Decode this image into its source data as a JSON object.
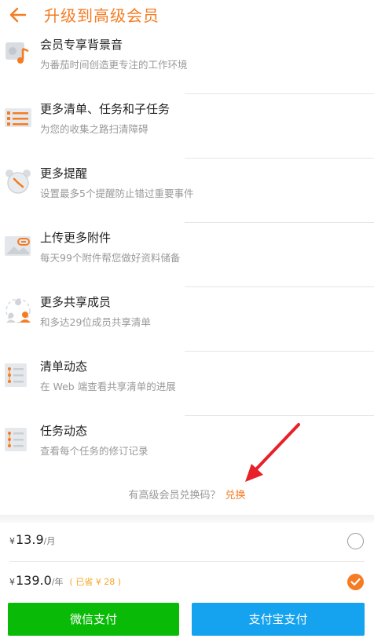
{
  "header": {
    "title": "升级到高级会员"
  },
  "features": [
    {
      "title": "会员专享背景音",
      "desc": "为番茄时间创造更专注的工作环境",
      "icon": "music-note-icon"
    },
    {
      "title": "更多清单、任务和子任务",
      "desc": "为您的收集之路扫清障碍",
      "icon": "list-icon"
    },
    {
      "title": "更多提醒",
      "desc": "设置最多5个提醒防止错过重要事件",
      "icon": "alarm-clock-icon"
    },
    {
      "title": "上传更多附件",
      "desc": "每天99个附件帮您做好资料储备",
      "icon": "attachment-icon"
    },
    {
      "title": "更多共享成员",
      "desc": "和多达29位成员共享清单",
      "icon": "shared-members-icon"
    },
    {
      "title": "清单动态",
      "desc": "在 Web 端查看共享清单的进展",
      "icon": "list-activity-icon"
    },
    {
      "title": "任务动态",
      "desc": "查看每个任务的修订记录",
      "icon": "task-activity-icon"
    }
  ],
  "redeem": {
    "prompt": "有高级会员兑换码？",
    "link": "兑换"
  },
  "plans": {
    "monthly": {
      "currency": "¥",
      "amount": "13.9",
      "unit": "/月",
      "selected": false
    },
    "yearly": {
      "currency": "¥",
      "amount": "139.0",
      "unit": "/年",
      "save": "( 已省 ¥ 28 )",
      "selected": true
    }
  },
  "payment": {
    "wechat": "微信支付",
    "alipay": "支付宝支付"
  },
  "colors": {
    "accent": "#f57c22",
    "wechat": "#09bb07",
    "alipay": "#15a3f0"
  }
}
